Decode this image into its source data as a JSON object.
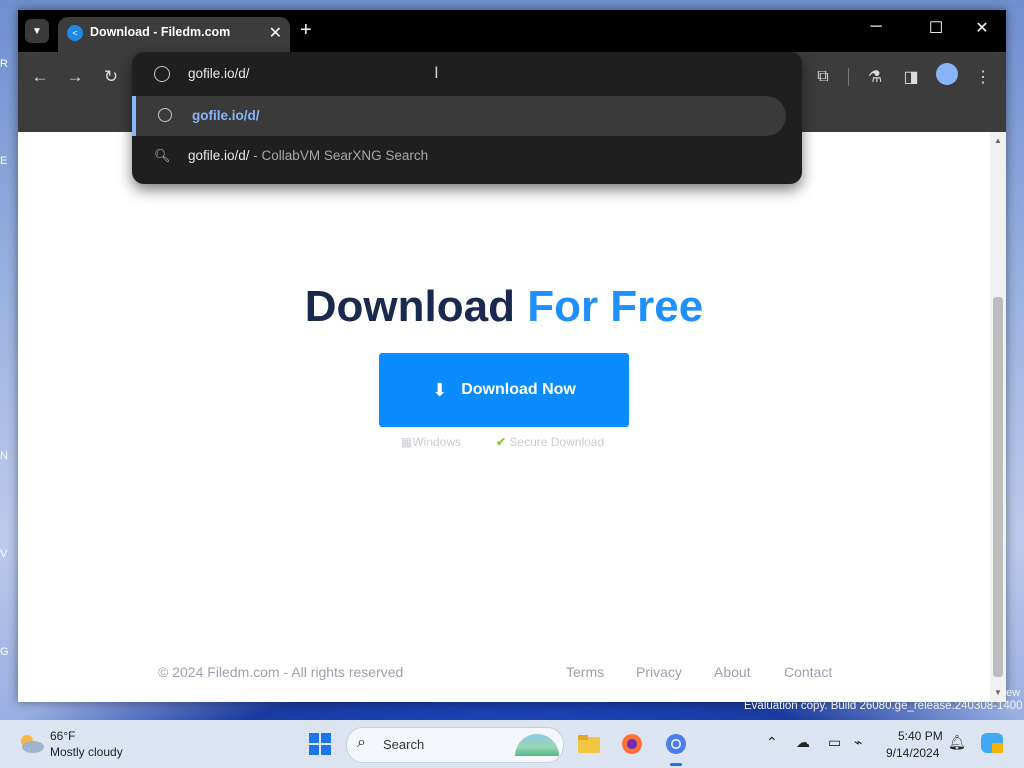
{
  "browser": {
    "tab_title": "Download - Filedm.com",
    "omnibox": {
      "text": "gofile.io/d/",
      "suggestions": [
        {
          "text": "gofile.io/d/",
          "sub": "",
          "icon": "globe-icon",
          "selected": true
        },
        {
          "text": "gofile.io/d/",
          "sub": " - CollabVM SearXNG Search",
          "icon": "search-icon",
          "selected": false
        }
      ]
    }
  },
  "page": {
    "headline_main": "Download",
    "headline_accent": "For Free",
    "download_button": "Download Now",
    "meta_windows": "Windows",
    "meta_secure": "Secure Download",
    "footer": {
      "copyright": "© 2024 Filedm.com - All rights reserved",
      "links": [
        "Terms",
        "Privacy",
        "About",
        "Contact"
      ]
    },
    "colors": {
      "accent": "#1e90ff",
      "heading": "#1a2a4f",
      "button": "#0a8cff"
    }
  },
  "watermark": "Evaluation copy. Build 26080.ge_release.240308-1400",
  "watermark_edge": "ew",
  "taskbar": {
    "weather_temp": "66°F",
    "weather_desc": "Mostly cloudy",
    "search_label": "Search",
    "clock_time": "5:40 PM",
    "clock_date": "9/14/2024"
  }
}
